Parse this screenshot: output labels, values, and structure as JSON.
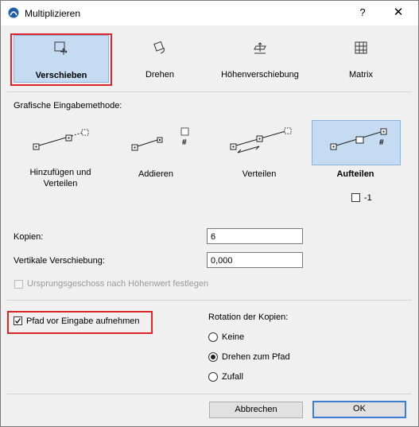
{
  "window": {
    "title": "Multiplizieren",
    "help": "?",
    "close": "✕"
  },
  "tabs": [
    {
      "label": "Verschieben",
      "icon": "move-icon",
      "selected": true
    },
    {
      "label": "Drehen",
      "icon": "rotate-icon",
      "selected": false
    },
    {
      "label": "Höhenverschiebung",
      "icon": "elevate-icon",
      "selected": false
    },
    {
      "label": "Matrix",
      "icon": "matrix-icon",
      "selected": false
    }
  ],
  "input_method": {
    "heading": "Grafische Eingabemethode:",
    "options": [
      {
        "label": "Hinzufügen und Verteilen",
        "selected": false
      },
      {
        "label": "Addieren",
        "selected": false
      },
      {
        "label": "Verteilen",
        "selected": false
      },
      {
        "label": "Aufteilen",
        "selected": true
      }
    ],
    "minus_one_label": "-1",
    "hash": "#"
  },
  "fields": {
    "copies_label": "Kopien:",
    "copies_value": "6",
    "vertical_label": "Vertikale Verschiebung:",
    "vertical_value": "0,000"
  },
  "origin_story_label": "Ursprungsgeschoss nach Höhenwert festlegen",
  "record_path": {
    "label": "Pfad vor Eingabe aufnehmen",
    "checked": true
  },
  "rotation": {
    "heading": "Rotation der Kopien:",
    "options": [
      "Keine",
      "Drehen zum Pfad",
      "Zufall"
    ],
    "selected": "Drehen zum Pfad"
  },
  "buttons": {
    "cancel": "Abbrechen",
    "ok": "OK"
  },
  "colors": {
    "highlight": "#e0242c",
    "selection": "#c4dbf2",
    "accent": "#3c7fd0"
  }
}
